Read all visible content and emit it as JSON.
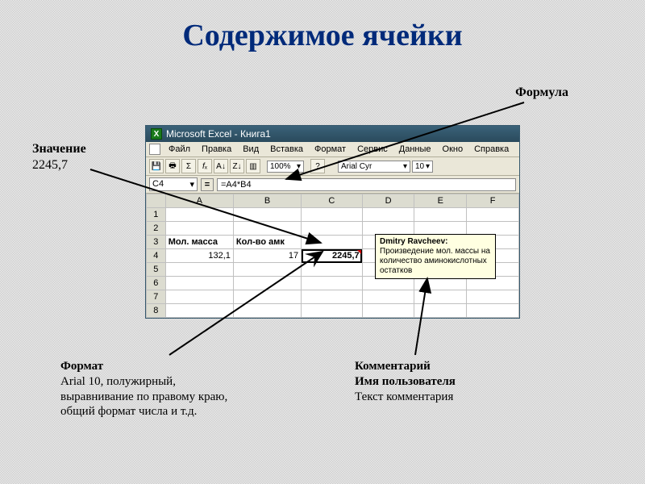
{
  "slide": {
    "title": "Содержимое ячейки"
  },
  "labels": {
    "formula": "Формула",
    "value_title": "Значение",
    "value_number": "2245,7",
    "format_title": "Формат",
    "format_text": "Arial 10, полужирный,\n выравнивание по правому краю,\nобщий формат числа и т.д.",
    "comment_title": "Комментарий",
    "comment_l1": "Имя пользователя",
    "comment_l2": "Текст комментария"
  },
  "excel": {
    "window_title": "Microsoft Excel - Книга1",
    "menu": [
      "Файл",
      "Правка",
      "Вид",
      "Вставка",
      "Формат",
      "Сервис",
      "Данные",
      "Окно",
      "Справка"
    ],
    "zoom": "100%",
    "font": "Arial Cyr",
    "fontsize": "10",
    "active_cell": "C4",
    "formula": "=A4*B4",
    "columns": [
      "A",
      "B",
      "C",
      "D",
      "E",
      "F"
    ],
    "rows": [
      "1",
      "2",
      "3",
      "4",
      "5",
      "6",
      "7",
      "8"
    ],
    "cells": {
      "A3": "Мол. масса",
      "B3": "Кол-во амк",
      "A4": "132,1",
      "B4": "17",
      "C4": "2245,7"
    },
    "comment": {
      "author": "Dmitry Ravcheev:",
      "text": "Произведение мол. массы на количество аминокислотных остатков"
    }
  }
}
